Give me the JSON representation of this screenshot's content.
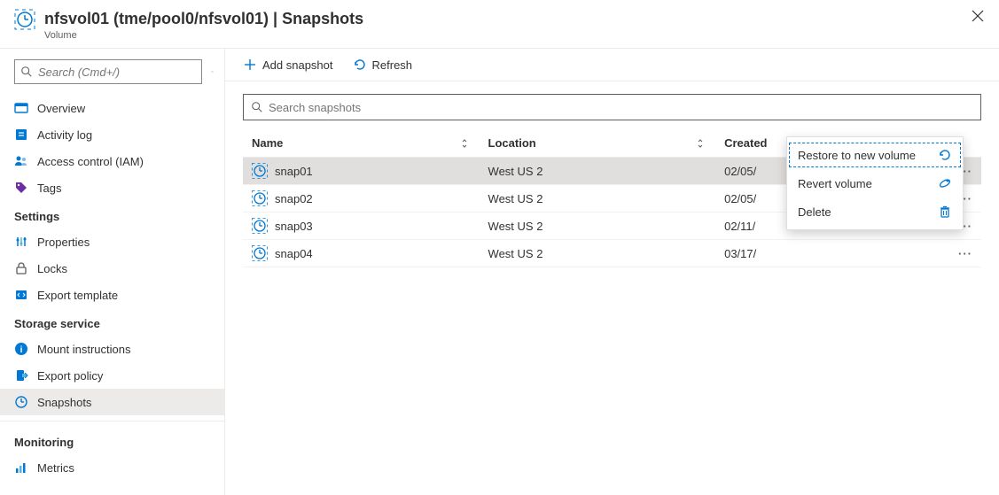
{
  "header": {
    "title": "nfsvol01 (tme/pool0/nfsvol01) | Snapshots",
    "subtitle": "Volume"
  },
  "sidebar": {
    "search_placeholder": "Search (Cmd+/)",
    "items": [
      {
        "label": "Overview",
        "icon": "overview"
      },
      {
        "label": "Activity log",
        "icon": "activity-log"
      },
      {
        "label": "Access control (IAM)",
        "icon": "access-control"
      },
      {
        "label": "Tags",
        "icon": "tags"
      }
    ],
    "groups": [
      {
        "title": "Settings",
        "items": [
          {
            "label": "Properties",
            "icon": "properties"
          },
          {
            "label": "Locks",
            "icon": "locks"
          },
          {
            "label": "Export template",
            "icon": "export-template"
          }
        ]
      },
      {
        "title": "Storage service",
        "items": [
          {
            "label": "Mount instructions",
            "icon": "info"
          },
          {
            "label": "Export policy",
            "icon": "export-policy"
          },
          {
            "label": "Snapshots",
            "icon": "snapshot",
            "active": true
          }
        ]
      },
      {
        "title": "Monitoring",
        "items": [
          {
            "label": "Metrics",
            "icon": "metrics"
          }
        ]
      }
    ]
  },
  "commandbar": {
    "add": "Add snapshot",
    "refresh": "Refresh"
  },
  "snapshot_search_placeholder": "Search snapshots",
  "columns": {
    "name": "Name",
    "location": "Location",
    "created": "Created"
  },
  "rows": [
    {
      "name": "snap01",
      "location": "West US 2",
      "created": "02/05/"
    },
    {
      "name": "snap02",
      "location": "West US 2",
      "created": "02/05/"
    },
    {
      "name": "snap03",
      "location": "West US 2",
      "created": "02/11/"
    },
    {
      "name": "snap04",
      "location": "West US 2",
      "created": "03/17/"
    }
  ],
  "context_menu": {
    "restore": "Restore to new volume",
    "revert": "Revert volume",
    "delete": "Delete"
  }
}
